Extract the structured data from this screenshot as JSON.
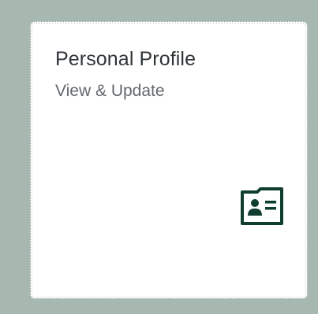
{
  "tile": {
    "title": "Personal Profile",
    "subtitle": "View & Update",
    "icon": "contact-card-icon",
    "icon_color": "#0f3e30",
    "background": "#ffffff"
  },
  "page": {
    "background": "#a7b8b1"
  }
}
